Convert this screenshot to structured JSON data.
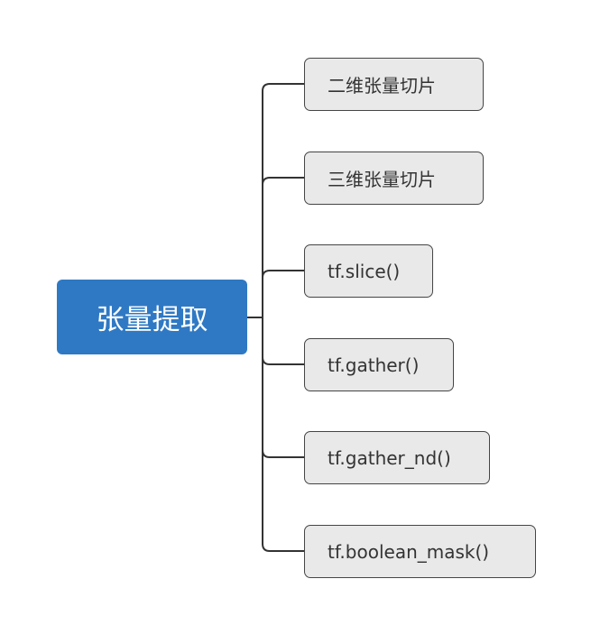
{
  "mindmap": {
    "root": {
      "label": "张量提取",
      "color": "#2f79c4"
    },
    "children": [
      {
        "label": "二维张量切片"
      },
      {
        "label": "三维张量切片"
      },
      {
        "label": "tf.slice()"
      },
      {
        "label": "tf.gather()"
      },
      {
        "label": "tf.gather_nd()"
      },
      {
        "label": "tf.boolean_mask()"
      }
    ],
    "line_color": "#333333",
    "child_fill": "#e9e9e9"
  }
}
